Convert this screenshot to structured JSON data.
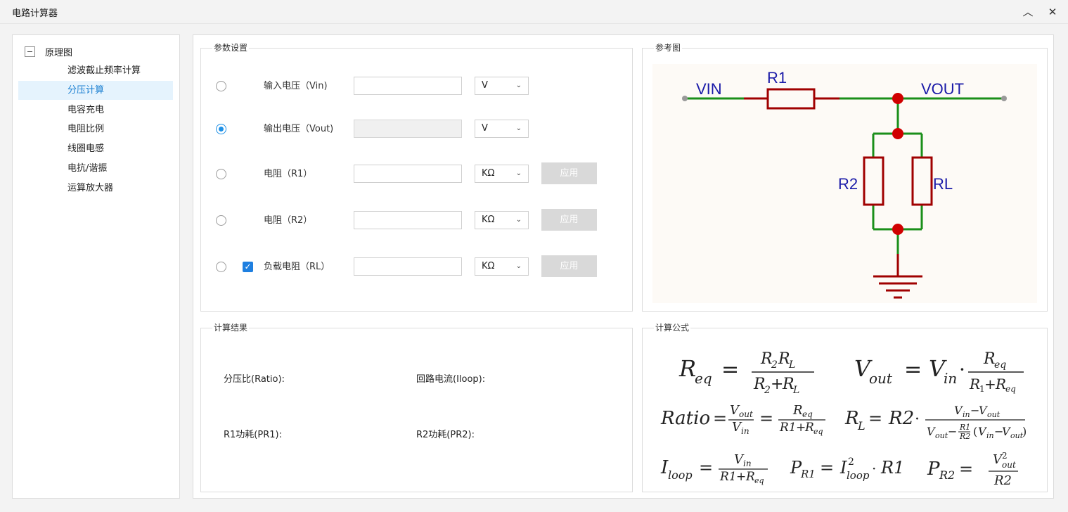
{
  "window": {
    "title": "电路计算器",
    "minimize_glyph": "︿",
    "close_glyph": "✕"
  },
  "tree": {
    "root_label": "原理图",
    "items": [
      {
        "label": "滤波截止频率计算",
        "selected": false
      },
      {
        "label": "分压计算",
        "selected": true
      },
      {
        "label": "电容充电",
        "selected": false
      },
      {
        "label": "电阻比例",
        "selected": false
      },
      {
        "label": "线圈电感",
        "selected": false
      },
      {
        "label": "电抗/谐振",
        "selected": false
      },
      {
        "label": "运算放大器",
        "selected": false
      }
    ]
  },
  "params": {
    "title": "参数设置",
    "rows": [
      {
        "label": "输入电压（Vin)",
        "value": "",
        "unit": "V",
        "radio_checked": false,
        "input_disabled": false,
        "has_apply": false,
        "has_checkbox": false
      },
      {
        "label": "输出电压（Vout)",
        "value": "",
        "unit": "V",
        "radio_checked": true,
        "input_disabled": true,
        "has_apply": false,
        "has_checkbox": false
      },
      {
        "label": "电阻（R1）",
        "value": "",
        "unit": "KΩ",
        "radio_checked": false,
        "input_disabled": false,
        "has_apply": true,
        "has_checkbox": false
      },
      {
        "label": "电阻（R2）",
        "value": "",
        "unit": "KΩ",
        "radio_checked": false,
        "input_disabled": false,
        "has_apply": true,
        "has_checkbox": false
      },
      {
        "label": "负载电阻（RL）",
        "value": "",
        "unit": "KΩ",
        "radio_checked": false,
        "input_disabled": false,
        "has_apply": true,
        "has_checkbox": true,
        "checkbox_checked": true
      }
    ],
    "apply_label": "应用",
    "checkbox_glyph": "✓",
    "dropdown_glyph": "⌄"
  },
  "reference": {
    "title": "参考图",
    "labels": {
      "vin": "VIN",
      "vout": "VOUT",
      "r1": "R1",
      "r2": "R2",
      "rl": "RL"
    },
    "colors": {
      "wire": "#1a8f1a",
      "resistor": "#a00000",
      "node": "#d00000",
      "text": "#1a1aa8",
      "terminal": "#999999",
      "background": "#fdfaf6"
    }
  },
  "results": {
    "title": "计算结果",
    "ratio_label": "分压比(Ratio):",
    "loop_label": "回路电流(Iloop):",
    "pr1_label": "R1功耗(PR1):",
    "pr2_label": "R2功耗(PR2):"
  },
  "formulas": {
    "title": "计算公式"
  }
}
